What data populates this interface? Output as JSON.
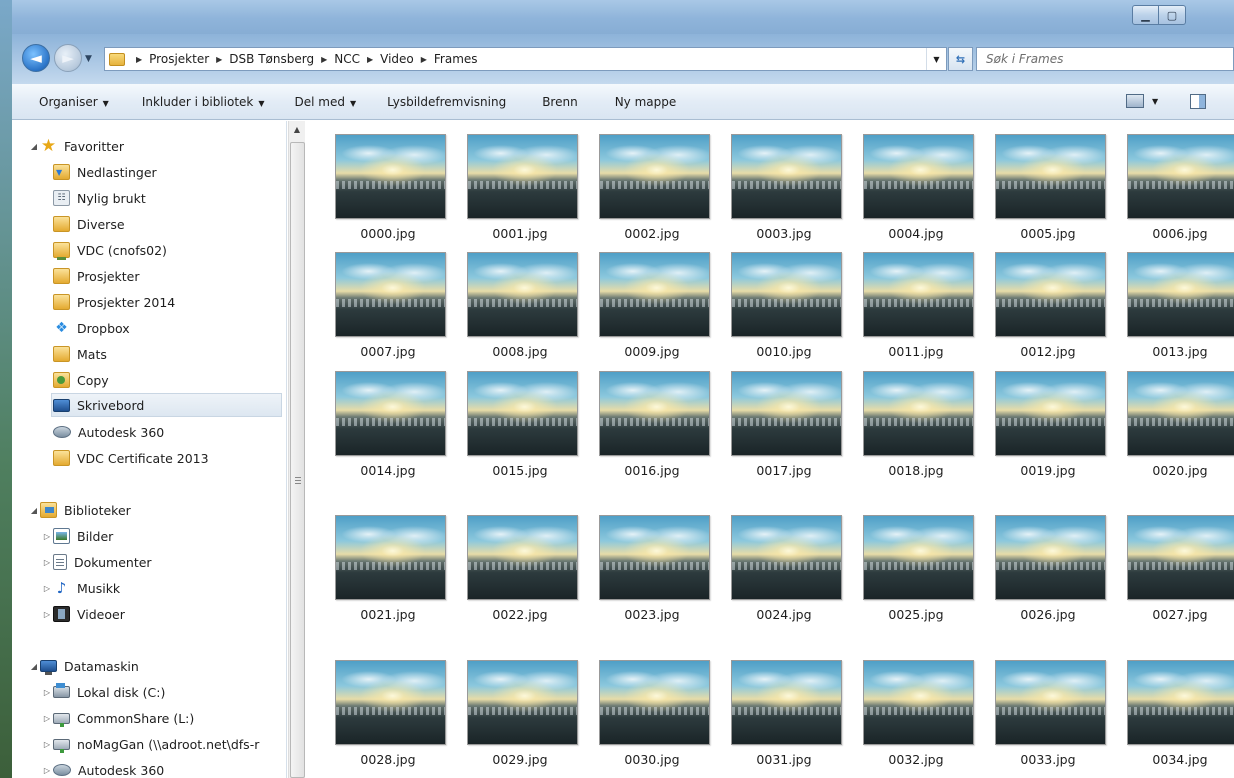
{
  "address": {
    "crumbs": [
      "Prosjekter",
      "DSB Tønsberg",
      "NCC",
      "Video",
      "Frames"
    ]
  },
  "search": {
    "placeholder": "Søk i Frames"
  },
  "toolbar": {
    "organize": "Organiser",
    "include_library": "Inkluder i bibliotek",
    "share_with": "Del med",
    "slideshow": "Lysbildefremvisning",
    "burn": "Brenn",
    "new_folder": "Ny mappe"
  },
  "nav": {
    "favorites": {
      "label": "Favoritter",
      "items": [
        {
          "label": "Nedlastinger",
          "icon": "downloads-icon"
        },
        {
          "label": "Nylig brukt",
          "icon": "recent-places-icon"
        },
        {
          "label": "Diverse",
          "icon": "folder-icon"
        },
        {
          "label": "VDC (cnofs02)",
          "icon": "network-folder-icon"
        },
        {
          "label": "Prosjekter",
          "icon": "folder-icon"
        },
        {
          "label": "Prosjekter 2014",
          "icon": "folder-icon"
        },
        {
          "label": "Dropbox",
          "icon": "dropbox-icon"
        },
        {
          "label": "Mats",
          "icon": "folder-icon"
        },
        {
          "label": "Copy",
          "icon": "copy-folder-icon"
        },
        {
          "label": "Skrivebord",
          "icon": "desktop-icon"
        },
        {
          "label": "Autodesk 360",
          "icon": "autodesk-360-icon"
        },
        {
          "label": "VDC Certificate 2013",
          "icon": "folder-icon"
        }
      ]
    },
    "libraries": {
      "label": "Biblioteker",
      "items": [
        {
          "label": "Bilder",
          "icon": "pictures-icon"
        },
        {
          "label": "Dokumenter",
          "icon": "documents-icon"
        },
        {
          "label": "Musikk",
          "icon": "music-icon"
        },
        {
          "label": "Videoer",
          "icon": "videos-icon"
        }
      ]
    },
    "computer": {
      "label": "Datamaskin",
      "items": [
        {
          "label": "Lokal disk (C:)",
          "icon": "local-disk-icon"
        },
        {
          "label": "CommonShare (L:)",
          "icon": "network-drive-icon"
        },
        {
          "label": "noMagGan (\\\\adroot.net\\dfs-r",
          "icon": "network-drive-icon"
        },
        {
          "label": "Autodesk 360",
          "icon": "autodesk-360-icon"
        }
      ]
    }
  },
  "files": [
    "0000.jpg",
    "0001.jpg",
    "0002.jpg",
    "0003.jpg",
    "0004.jpg",
    "0005.jpg",
    "0006.jpg",
    "0007.jpg",
    "0008.jpg",
    "0009.jpg",
    "0010.jpg",
    "0011.jpg",
    "0012.jpg",
    "0013.jpg",
    "0014.jpg",
    "0015.jpg",
    "0016.jpg",
    "0017.jpg",
    "0018.jpg",
    "0019.jpg",
    "0020.jpg",
    "0021.jpg",
    "0022.jpg",
    "0023.jpg",
    "0024.jpg",
    "0025.jpg",
    "0026.jpg",
    "0027.jpg",
    "0028.jpg",
    "0029.jpg",
    "0030.jpg",
    "0031.jpg",
    "0032.jpg",
    "0033.jpg",
    "0034.jpg"
  ],
  "colors": {
    "accent": "#2b74c8",
    "selected_bg": "#dde7f1",
    "toolbar_bg": "#e3ecf6"
  }
}
